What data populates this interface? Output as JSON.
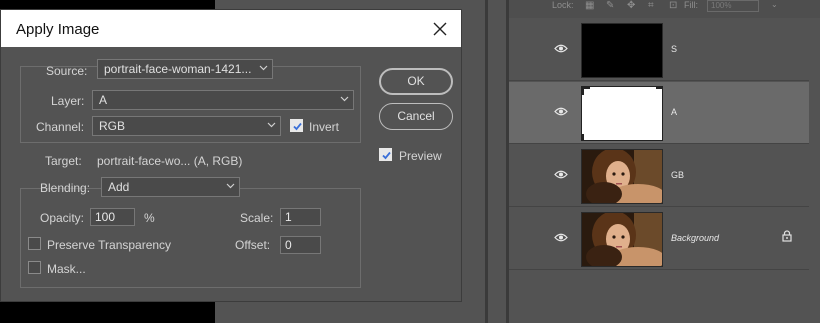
{
  "dialog": {
    "title": "Apply Image",
    "source_label": "Source:",
    "source_value": "portrait-face-woman-1421...",
    "layer_label": "Layer:",
    "layer_value": "A",
    "channel_label": "Channel:",
    "channel_value": "RGB",
    "invert_label": "Invert",
    "invert_checked": true,
    "target_label": "Target:",
    "target_value": "portrait-face-wo... (A, RGB)",
    "blending_label": "Blending:",
    "blending_value": "Add",
    "opacity_label": "Opacity:",
    "opacity_value": "100",
    "opacity_unit": "%",
    "scale_label": "Scale:",
    "scale_value": "1",
    "offset_label": "Offset:",
    "offset_value": "0",
    "preserve_label": "Preserve Transparency",
    "preserve_checked": false,
    "mask_label": "Mask...",
    "mask_checked": false,
    "ok_label": "OK",
    "cancel_label": "Cancel",
    "preview_label": "Preview",
    "preview_checked": true
  },
  "layers_panel": {
    "lock_label": "Lock:",
    "fill_label": "Fill:",
    "fill_value": "100%",
    "layers": [
      {
        "name": "S",
        "thumb": "black",
        "selected": false,
        "visible": true
      },
      {
        "name": "A",
        "thumb": "white",
        "selected": true,
        "visible": true
      },
      {
        "name": "GB",
        "thumb": "portrait",
        "selected": false,
        "visible": true
      },
      {
        "name": "Background",
        "thumb": "portrait",
        "selected": false,
        "visible": true,
        "locked": true
      }
    ]
  },
  "colors": {
    "panel_bg": "#535353",
    "selected_row": "#6a6a6a",
    "titlebar": "#ffffff"
  }
}
